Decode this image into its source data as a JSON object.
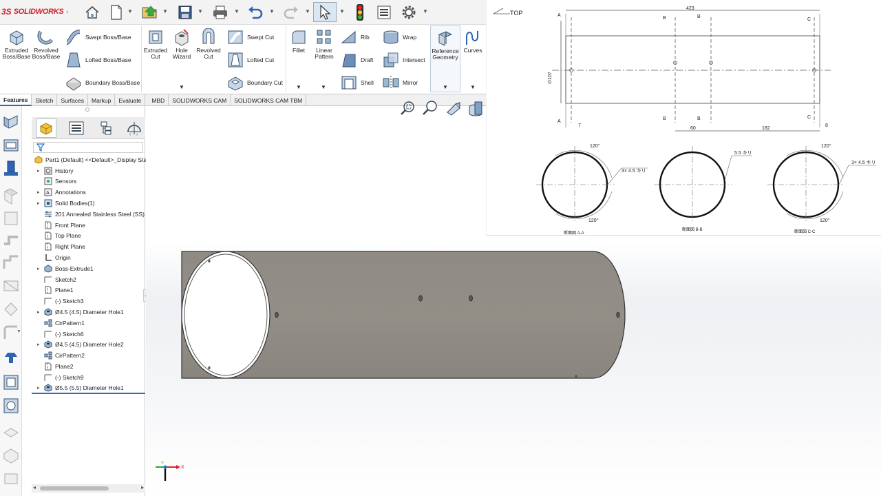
{
  "app": {
    "brand_ds": "3S",
    "brand_name": "SOLIDWORKS"
  },
  "ribbon": {
    "extruded_boss": [
      "Extruded",
      "Boss/Base"
    ],
    "revolved_boss": [
      "Revolved",
      "Boss/Base"
    ],
    "swept_boss": "Swept Boss/Base",
    "lofted_boss": "Lofted Boss/Base",
    "boundary_boss": "Boundary Boss/Base",
    "extruded_cut": [
      "Extruded",
      "Cut"
    ],
    "hole_wizard": [
      "Hole",
      "Wizard"
    ],
    "revolved_cut": [
      "Revolved",
      "Cut"
    ],
    "swept_cut": "Swept Cut",
    "lofted_cut": "Lofted Cut",
    "boundary_cut": "Boundary Cut",
    "fillet": "Fillet",
    "linear_pattern": [
      "Linear",
      "Pattern"
    ],
    "rib": "Rib",
    "draft": "Draft",
    "shell": "Shell",
    "wrap": "Wrap",
    "intersect": "Intersect",
    "mirror": "Mirror",
    "reference_geometry": [
      "Reference",
      "Geometry"
    ],
    "curves": "Curves"
  },
  "tabs": [
    "Features",
    "Sketch",
    "Surfaces",
    "Markup",
    "Evaluate",
    "MBD",
    "SOLIDWORKS CAM",
    "SOLIDWORKS CAM TBM"
  ],
  "tree": [
    {
      "label": "Part1 (Default) <<Default>_Display Sta",
      "icon": "part-icon",
      "level": 0,
      "expand": false
    },
    {
      "label": "History",
      "icon": "history-icon",
      "level": 1,
      "expand": true
    },
    {
      "label": "Sensors",
      "icon": "sensor-icon",
      "level": 1,
      "expand": false
    },
    {
      "label": "Annotations",
      "icon": "annotation-icon",
      "level": 1,
      "expand": true
    },
    {
      "label": "Solid Bodies(1)",
      "icon": "solid-bodies-icon",
      "level": 1,
      "expand": true
    },
    {
      "label": "201 Annealed Stainless Steel (SS)",
      "icon": "material-icon",
      "level": 1,
      "expand": false
    },
    {
      "label": "Front Plane",
      "icon": "plane-icon",
      "level": 1,
      "expand": false
    },
    {
      "label": "Top Plane",
      "icon": "plane-icon",
      "level": 1,
      "expand": false
    },
    {
      "label": "Right Plane",
      "icon": "plane-icon",
      "level": 1,
      "expand": false
    },
    {
      "label": "Origin",
      "icon": "origin-icon",
      "level": 1,
      "expand": false
    },
    {
      "label": "Boss-Extrude1",
      "icon": "extrude-feature-icon",
      "level": 1,
      "expand": true
    },
    {
      "label": "Sketch2",
      "icon": "sketch-icon",
      "level": 1,
      "expand": false
    },
    {
      "label": "Plane1",
      "icon": "plane-icon",
      "level": 1,
      "expand": false
    },
    {
      "label": "(-) Sketch3",
      "icon": "sketch-icon",
      "level": 1,
      "expand": false
    },
    {
      "label": "Ø4.5 (4.5) Diameter Hole1",
      "icon": "hole-feature-icon",
      "level": 1,
      "expand": true
    },
    {
      "label": "CirPattern1",
      "icon": "circular-pattern-icon",
      "level": 1,
      "expand": false
    },
    {
      "label": "(-) Sketch6",
      "icon": "sketch-icon",
      "level": 1,
      "expand": false
    },
    {
      "label": "Ø4.5 (4.5) Diameter Hole2",
      "icon": "hole-feature-icon",
      "level": 1,
      "expand": true
    },
    {
      "label": "CirPattern2",
      "icon": "circular-pattern-icon",
      "level": 1,
      "expand": false
    },
    {
      "label": "Plane2",
      "icon": "plane-icon",
      "level": 1,
      "expand": false
    },
    {
      "label": "(-) Sketch9",
      "icon": "sketch-icon",
      "level": 1,
      "expand": false
    },
    {
      "label": "Ø5.5 (5.5) Diameter Hole1",
      "icon": "hole-feature-icon",
      "level": 1,
      "expand": true
    }
  ],
  "drawing": {
    "view_label": "TOP",
    "total_length": "423",
    "diameter_label": "∅107",
    "dim_60": "60",
    "dim_182": "182",
    "dim_7": "7",
    "dim_8": "8",
    "section_A": "A",
    "section_B": "B",
    "section_C": "C",
    "note_aa": "3× 4.5 キリ",
    "note_bb": "5.5 キリ",
    "note_cc": "3× 4.5 キリ",
    "angle_120": "120°",
    "caption_aa": "断面図 A-A",
    "caption_bb": "断面図 B-B",
    "caption_cc": "断面図 C-C"
  },
  "triad": {
    "x": "X",
    "y": "Y"
  },
  "colors": {
    "accent": "#1f6fc5",
    "body": "#8f8a83",
    "brand": "#d41f27"
  }
}
